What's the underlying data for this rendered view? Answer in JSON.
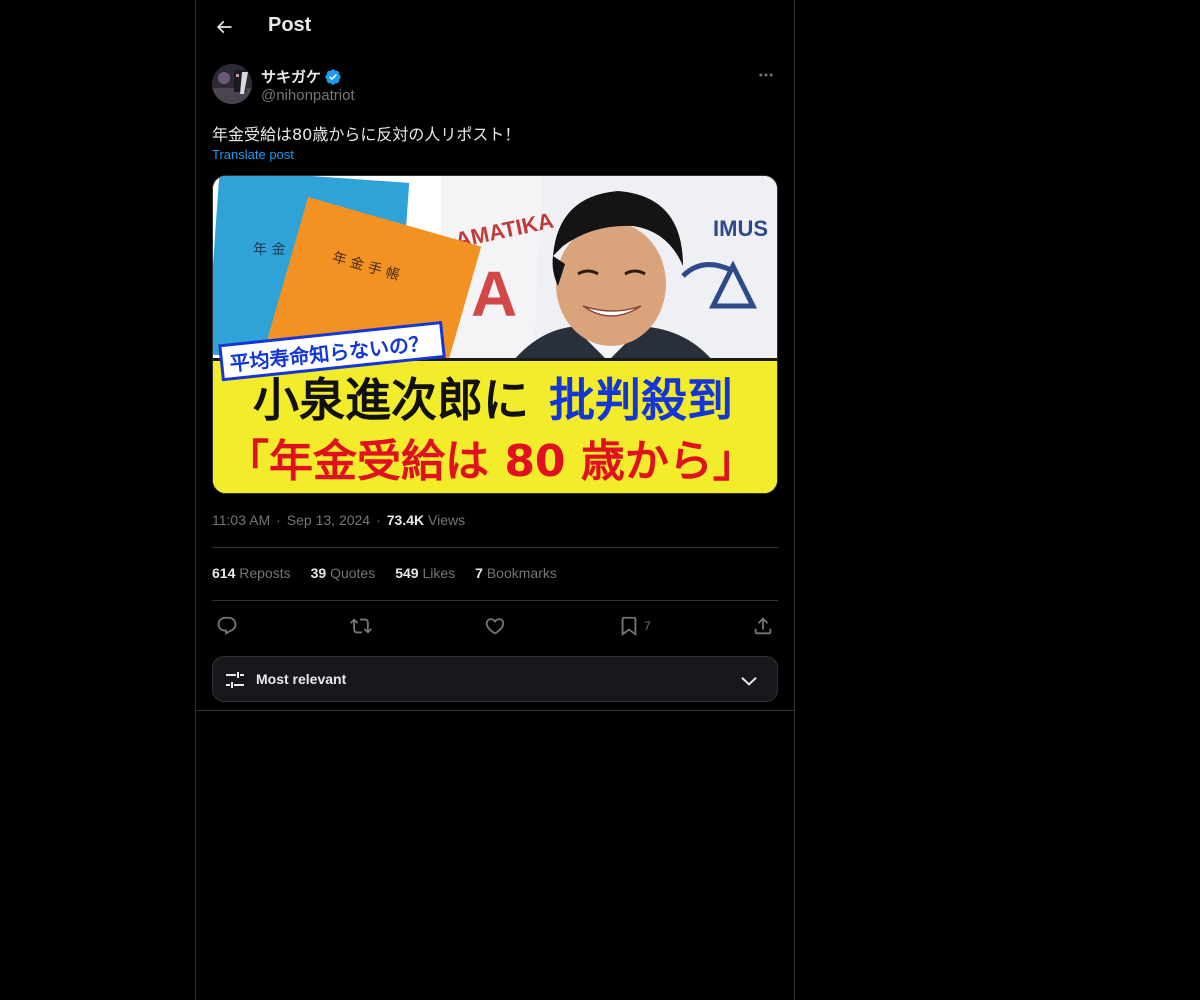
{
  "header": {
    "title": "Post"
  },
  "author": {
    "display_name": "サキガケ",
    "handle": "@nihonpatriot",
    "verified": true
  },
  "post": {
    "text": "年金受給は80歳からに反対の人リポスト！",
    "translate_label": "Translate post",
    "image": {
      "caption_tag": "平均寿命知らないの？",
      "headline_black": "小泉進次郎に",
      "headline_blue": "批判殺到",
      "headline_red": "「年金受給は 80 歳から」",
      "book_blue_text": "年 金",
      "book_orange_text": "年 金 手 帳",
      "bg_text_a": "AMATIKA",
      "bg_text_b": "IMUS"
    },
    "time": "11:03 AM",
    "date": "Sep 13, 2024",
    "views_count": "73.4K",
    "views_label": "Views",
    "separator": "·"
  },
  "stats": {
    "reposts_count": "614",
    "reposts_label": "Reposts",
    "quotes_count": "39",
    "quotes_label": "Quotes",
    "likes_count": "549",
    "likes_label": "Likes",
    "bookmarks_count": "7",
    "bookmarks_label": "Bookmarks"
  },
  "actions": {
    "bookmark_count": "7"
  },
  "sort": {
    "label": "Most relevant"
  },
  "colors": {
    "background": "#000000",
    "text": "#e7e9ea",
    "muted": "#71767b",
    "accent": "#1d9bf0",
    "border": "#2f3336",
    "banner_yellow": "#f3ec2a",
    "headline_blue": "#1536d6",
    "headline_red": "#e01020"
  }
}
